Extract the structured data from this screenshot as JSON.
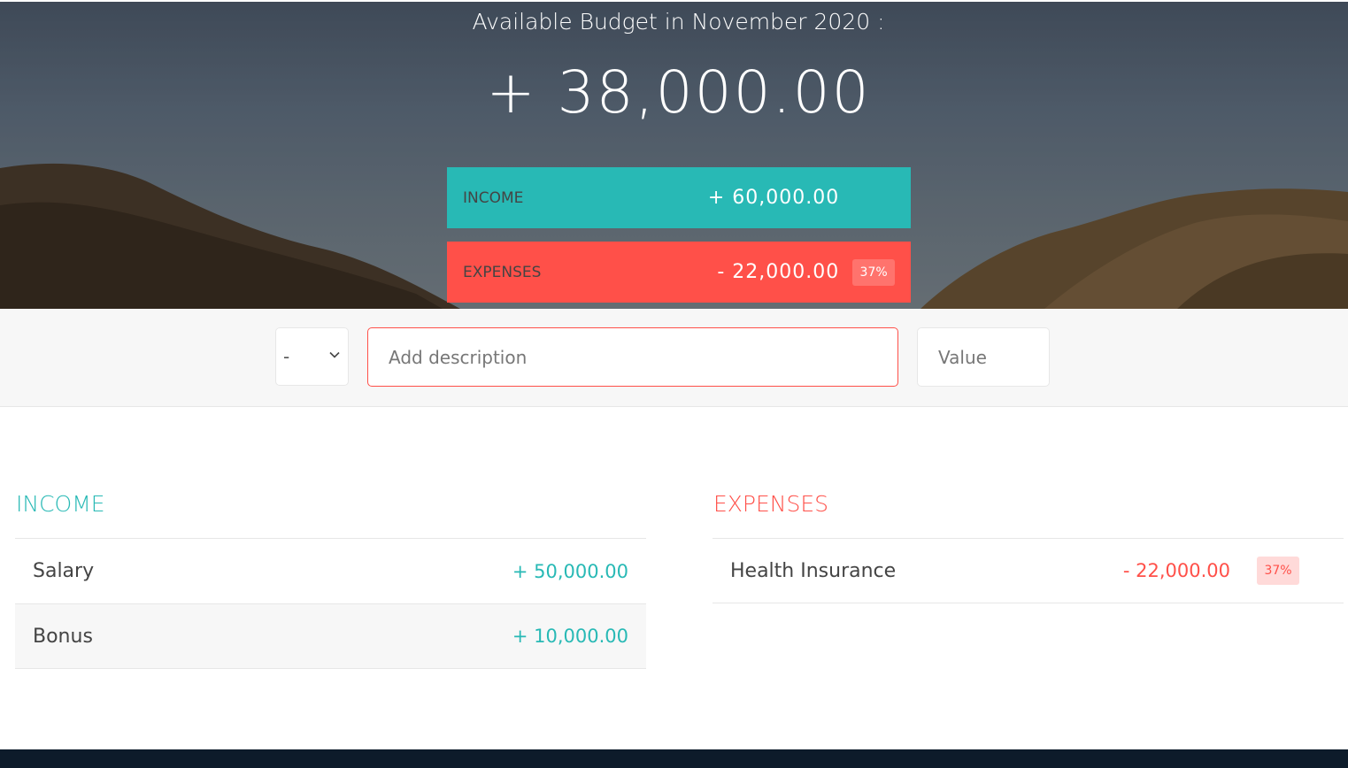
{
  "header": {
    "title": "Available Budget in November 2020 :",
    "budget": "+ 38,000.00"
  },
  "summary": {
    "income": {
      "label": "INCOME",
      "value": "+ 60,000.00"
    },
    "expenses": {
      "label": "EXPENSES",
      "value": "- 22,000.00",
      "percentage": "37%"
    }
  },
  "add_form": {
    "type_selected": "-",
    "description_placeholder": "Add description",
    "value_placeholder": "Value"
  },
  "income": {
    "title": "INCOME",
    "items": [
      {
        "description": "Salary",
        "value": "+ 50,000.00"
      },
      {
        "description": "Bonus",
        "value": "+ 10,000.00"
      }
    ]
  },
  "expenses": {
    "title": "EXPENSES",
    "items": [
      {
        "description": "Health Insurance",
        "value": "- 22,000.00",
        "percentage": "37%"
      }
    ]
  },
  "colors": {
    "income": "#28b9b5",
    "expenses": "#ff5049",
    "footer": "#0d1b2a"
  }
}
